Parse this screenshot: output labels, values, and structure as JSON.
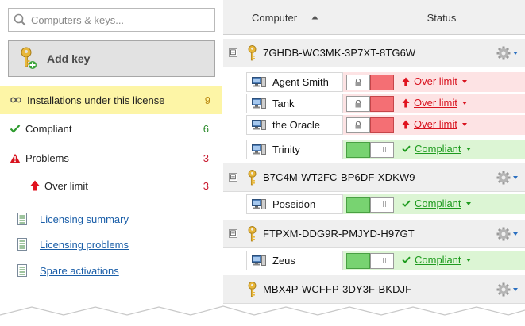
{
  "sidebar": {
    "search_placeholder": "Computers & keys...",
    "add_key_label": "Add key",
    "installations": {
      "label": "Installations under this license",
      "count": "9"
    },
    "compliant": {
      "label": "Compliant",
      "count": "6"
    },
    "problems": {
      "label": "Problems",
      "count": "3"
    },
    "over_limit": {
      "label": "Over limit",
      "count": "3"
    },
    "links": [
      "Licensing summary",
      "Licensing problems",
      "Spare activations"
    ]
  },
  "grid": {
    "columns": {
      "computer": "Computer",
      "status": "Status"
    },
    "keys": [
      {
        "key": "7GHDB-WC3MK-3P7XT-8TG6W",
        "computers": [
          {
            "name": "Agent Smith",
            "status": "Over limit"
          },
          {
            "name": "Tank",
            "status": "Over limit"
          },
          {
            "name": "the Oracle",
            "status": "Over limit"
          },
          {
            "name": "Trinity",
            "status": "Compliant"
          }
        ]
      },
      {
        "key": "B7C4M-WT2FC-BP6DF-XDKW9",
        "computers": [
          {
            "name": "Poseidon",
            "status": "Compliant"
          }
        ]
      },
      {
        "key": "FTPXM-DDG9R-PMJYD-H97GT",
        "computers": [
          {
            "name": "Zeus",
            "status": "Compliant"
          }
        ]
      },
      {
        "key": "MBX4P-WCFFP-3DY3F-BKDJF",
        "computers": []
      }
    ]
  },
  "toggle_symbol": "⊟",
  "icons": {
    "search": "search-icon",
    "key": "key-icon",
    "gear": "gear-icon",
    "computer": "computer-icon",
    "lock": "lock-icon",
    "document": "document-icon"
  },
  "colors": {
    "highlight": "#fdf5a6",
    "problem": "#d8121e",
    "compliant": "#1e9b1e",
    "link": "#1a5ea8",
    "problem_bg": "#fde3e4",
    "compliant_bg": "#dcf5d4"
  }
}
